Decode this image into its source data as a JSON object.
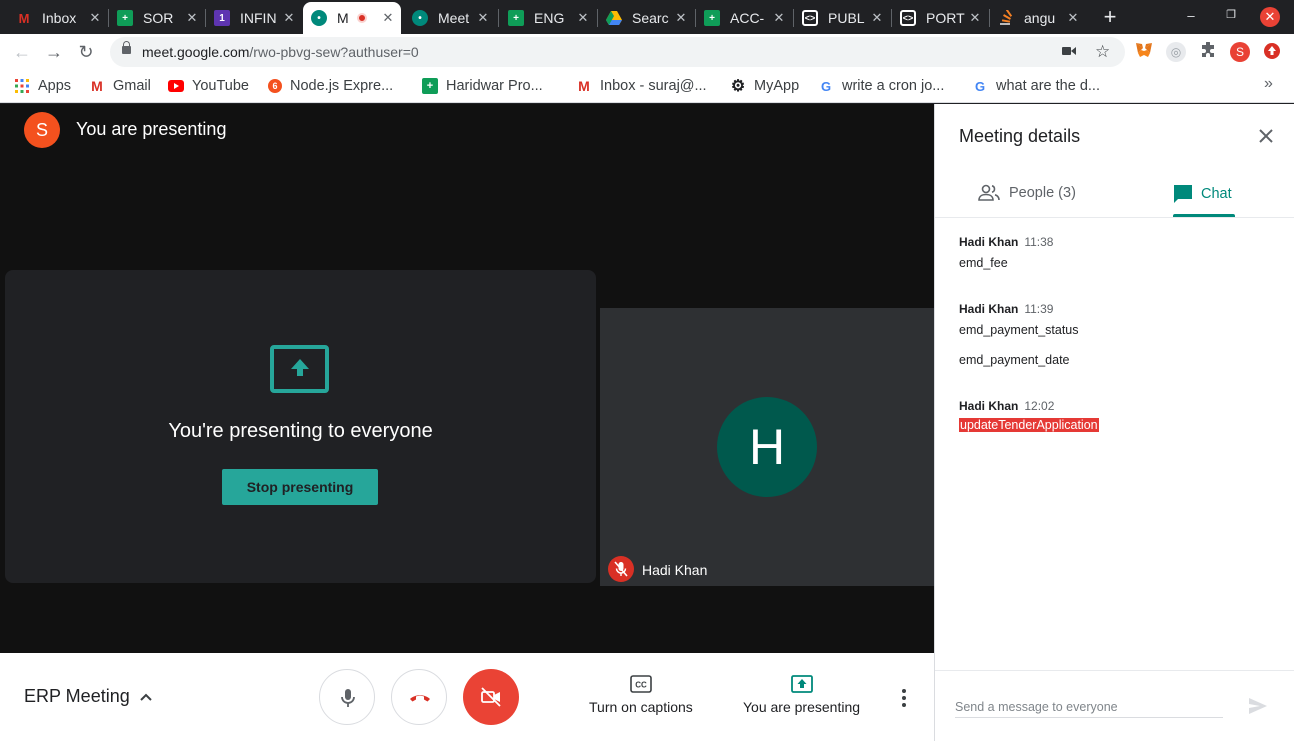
{
  "browser": {
    "tabs": [
      {
        "title": "Inbox",
        "icon": "gmail-icon",
        "color": "#d93025"
      },
      {
        "title": "SOR",
        "icon": "sheets-icon",
        "color": "#0f9d58"
      },
      {
        "title": "INFIN",
        "icon": "calendar-icon",
        "color": "#5e35b1"
      },
      {
        "title": "M",
        "icon": "meet-icon",
        "color": "#00897b"
      },
      {
        "title": "Meet",
        "icon": "meet-icon",
        "color": "#00897b"
      },
      {
        "title": "ENG",
        "icon": "sheets-icon",
        "color": "#0f9d58"
      },
      {
        "title": "Searc",
        "icon": "drive-icon",
        "color": "#fbbc04"
      },
      {
        "title": "ACC-",
        "icon": "sheets-icon",
        "color": "#0f9d58"
      },
      {
        "title": "PUBL",
        "icon": "code-icon",
        "color": "#ffffff"
      },
      {
        "title": "PORT",
        "icon": "code-icon",
        "color": "#ffffff"
      },
      {
        "title": "angu",
        "icon": "stackoverflow-icon",
        "color": "#f48024"
      }
    ],
    "url_host": "meet.google.com",
    "url_path": "/rwo-pbvg-sew?authuser=0",
    "profile_initial": "S",
    "bookmarks": [
      {
        "label": "Apps",
        "icon": "apps-grid-icon"
      },
      {
        "label": "Gmail",
        "icon": "gmail-icon"
      },
      {
        "label": "YouTube",
        "icon": "youtube-icon"
      },
      {
        "label": "Node.js Expre...",
        "icon": "node-icon"
      },
      {
        "label": "Haridwar Pro...",
        "icon": "sheets-icon"
      },
      {
        "label": "Inbox - suraj@...",
        "icon": "gmail-icon"
      },
      {
        "label": "MyApp",
        "icon": "gear-icon"
      },
      {
        "label": "write a cron jo...",
        "icon": "google-icon"
      },
      {
        "label": "what are the d...",
        "icon": "google-icon"
      }
    ]
  },
  "meet": {
    "user_initial": "S",
    "presenting_header": "You are presenting",
    "presenting_message": "You're presenting to everyone",
    "stop_button": "Stop presenting",
    "participant": {
      "initial": "H",
      "name": "Hadi Khan"
    },
    "meeting_name": "ERP Meeting",
    "captions_label": "Turn on captions",
    "present_label": "You are presenting"
  },
  "panel": {
    "title": "Meeting details",
    "people_tab": "People (3)",
    "chat_tab": "Chat",
    "messages": [
      {
        "sender": "Hadi Khan",
        "time": "11:38",
        "lines": [
          "emd_fee"
        ]
      },
      {
        "sender": "Hadi Khan",
        "time": "11:39",
        "lines": [
          "emd_payment_status",
          "emd_payment_date"
        ]
      },
      {
        "sender": "Hadi Khan",
        "time": "12:02",
        "lines": [
          "updateTenderApplication"
        ]
      }
    ],
    "compose_placeholder": "Send a message to everyone"
  },
  "colors": {
    "accent": "#00897b",
    "present_teal": "#26a69a",
    "danger": "#ea4335"
  }
}
